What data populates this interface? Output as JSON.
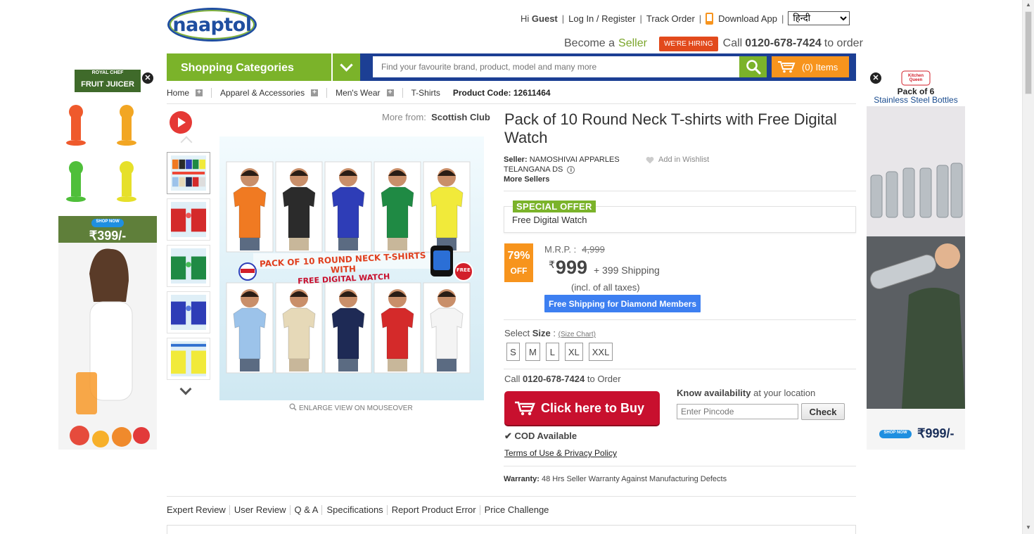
{
  "header": {
    "logo_text": "naaptol",
    "greeting_prefix": "Hi",
    "greeting_user": "Guest",
    "login_register": "Log In / Register",
    "track_order": "Track Order",
    "download_app": "Download App",
    "language_selected": "हिन्दी",
    "become_a": "Become a",
    "seller": "Seller",
    "hiring_badge": "WE'RE HIRING",
    "call_prefix": "Call",
    "phone": "0120-678-7424",
    "call_suffix": "to order"
  },
  "navbar": {
    "categories_label": "Shopping Categories",
    "search_placeholder": "Find your favourite brand, product, model and many more",
    "cart_label": "(0) Items",
    "accent_green": "#7bb32a",
    "accent_blue": "#1c3f94",
    "accent_orange": "#f7941d"
  },
  "breadcrumb": {
    "items": [
      "Home",
      "Apparel & Accessories",
      "Men's Wear",
      "T-Shirts"
    ],
    "product_code": "Product Code: 12611464"
  },
  "gallery": {
    "more_from_label": "More from:",
    "more_from_brand": "Scottish Club",
    "main_image_title": "PACK OF 10 ROUND NECK T-SHIRTS WITH",
    "main_image_subtitle": "FREE DIGITAL WATCH",
    "free_badge": "FREE",
    "enlarge_label": "ENLARGE VIEW ON MOUSEOVER",
    "shirt_colors_top": [
      "#f07a22",
      "#2b2b2b",
      "#2e3db7",
      "#1f8a44",
      "#f1ea3a"
    ],
    "shirt_colors_bottom": [
      "#9cc3ea",
      "#e6d9b8",
      "#1e2a55",
      "#d42a2a",
      "#f4f4f4"
    ]
  },
  "product": {
    "title": "Pack of 10 Round Neck T-shirts with Free Digital Watch",
    "seller_label": "Seller:",
    "seller_name": "NAMOSHIVAI APPARLES TELANGANA DS",
    "more_sellers": "More Sellers",
    "wishlist": "Add in Wishlist",
    "special_offer_tag": "SPECIAL OFFER",
    "special_offer_text": "Free Digital Watch",
    "discount_pct": "79%",
    "discount_off": "OFF",
    "mrp_label": "M.R.P. :",
    "mrp_value": "4,999",
    "rupee": "₹",
    "price": "999",
    "shipping": "+ 399 Shipping",
    "taxes": "(incl. of all taxes)",
    "diamond_shipping": "Free Shipping for Diamond Members",
    "select_label": "Select",
    "size_label": "Size",
    "size_chart": "(Size Chart)",
    "sizes": [
      "S",
      "M",
      "L",
      "XL",
      "XXL"
    ],
    "call_prefix": "Call",
    "call_phone": "0120-678-7424",
    "call_suffix": "to Order",
    "buy_label": "Click here to Buy",
    "availability_bold": "Know availability",
    "availability_rest": "at your location",
    "pincode_placeholder": "Enter Pincode",
    "check_label": "Check",
    "cod": "COD Available",
    "terms": "Terms of Use & Privacy Policy",
    "warranty_label": "Warranty:",
    "warranty_text": "48 Hrs Seller Warranty Against Manufacturing Defects"
  },
  "tabs": [
    "Expert Review",
    "User Review",
    "Q & A",
    "Specifications",
    "Report Product Error",
    "Price Challenge"
  ],
  "ads": {
    "left": {
      "brand": "ROYAL CHEF",
      "headline": "FRUIT JUICER",
      "cta": "SHOP NOW",
      "price": "₹399/-"
    },
    "right": {
      "brand": "Kitchen Queen",
      "headline_1": "Pack of 6",
      "headline_2": "Stainless Steel Bottles",
      "cta": "SHOP NOW",
      "price": "₹999/-"
    }
  }
}
